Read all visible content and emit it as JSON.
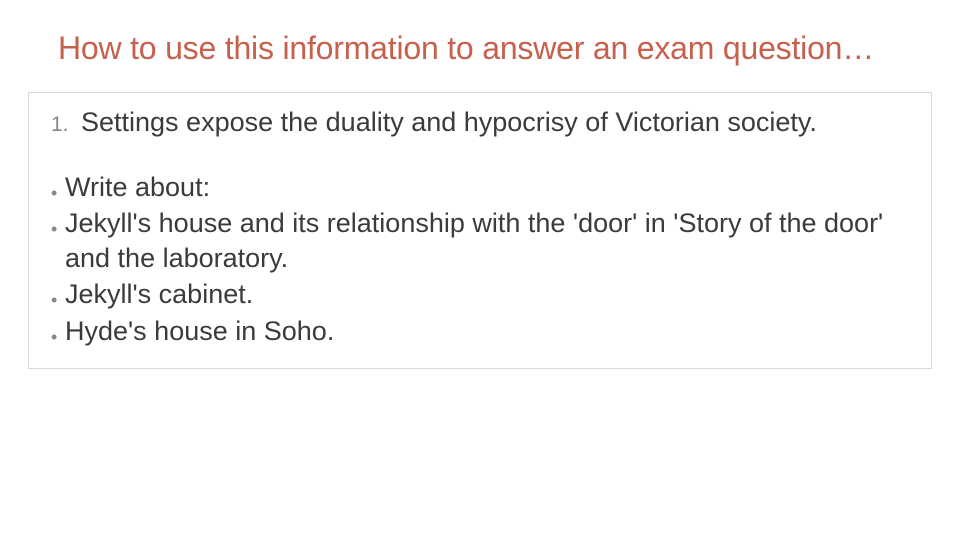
{
  "title": "How to use this information to answer an exam question…",
  "numbered": {
    "marker": "1.",
    "text": "Settings expose the duality and hypocrisy of Victorian society."
  },
  "bullets": [
    "Write about:",
    "Jekyll's house and its relationship with the 'door' in 'Story of the door' and the laboratory.",
    "Jekyll's cabinet.",
    "Hyde's house in Soho."
  ],
  "bullet_glyph": "•"
}
